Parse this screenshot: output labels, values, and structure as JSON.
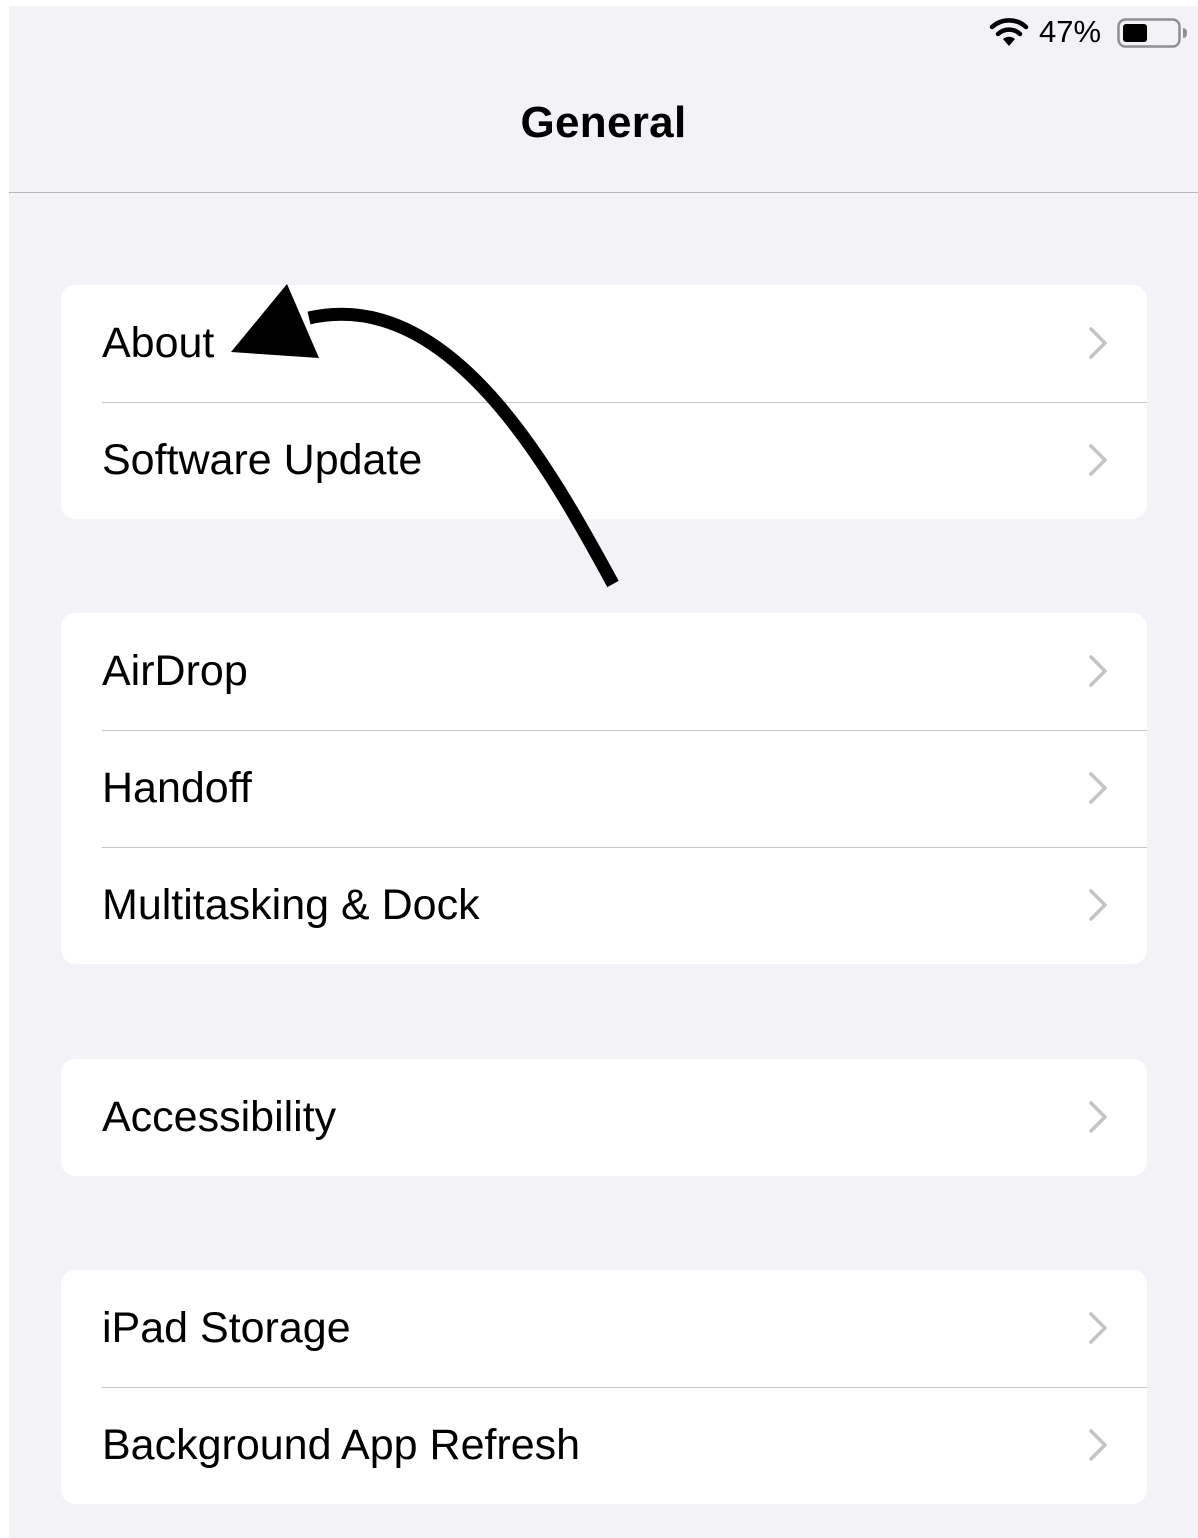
{
  "status_bar": {
    "battery_percent_text": "47%",
    "battery_level": 0.47,
    "wifi_icon": "wifi-icon",
    "battery_icon": "battery-icon"
  },
  "nav": {
    "title": "General"
  },
  "groups": [
    {
      "items": [
        {
          "label": "About"
        },
        {
          "label": "Software Update"
        }
      ]
    },
    {
      "items": [
        {
          "label": "AirDrop"
        },
        {
          "label": "Handoff"
        },
        {
          "label": "Multitasking & Dock"
        }
      ]
    },
    {
      "items": [
        {
          "label": "Accessibility"
        }
      ]
    },
    {
      "items": [
        {
          "label": "iPad Storage"
        },
        {
          "label": "Background App Refresh"
        }
      ]
    }
  ],
  "chevron_icon": "chevron-right-icon",
  "colors": {
    "background": "#f2f2f7",
    "cell": "#ffffff",
    "separator": "#c6c6c8",
    "chevron": "#c4c4c7",
    "annotation": "#000000"
  }
}
